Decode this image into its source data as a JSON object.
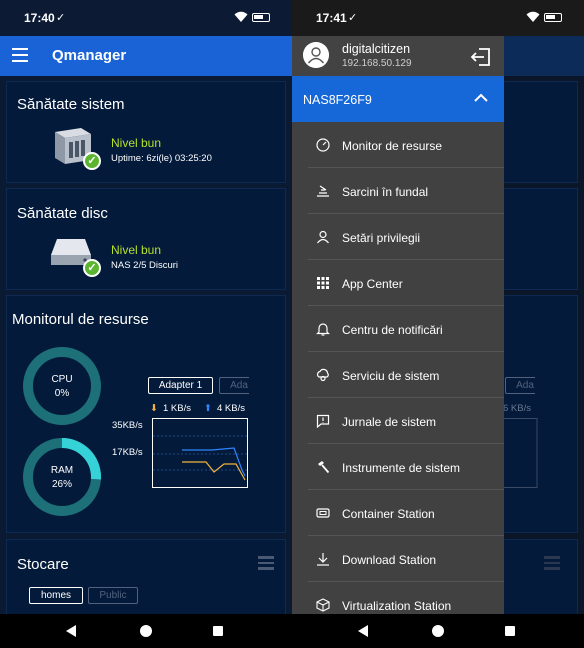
{
  "left": {
    "status_bar": {
      "time": "17:40",
      "check": "✓"
    },
    "app_title": "Qmanager",
    "system_health": {
      "title": "Sănătate sistem",
      "status": "Nivel bun",
      "detail": "Uptime: 6zi(le) 03:25:20"
    },
    "disk_health": {
      "title": "Sănătate disc",
      "status": "Nivel bun",
      "detail": "NAS 2/5 Discuri"
    },
    "resource_monitor": {
      "title": "Monitorul de resurse",
      "cpu": {
        "label": "CPU",
        "value": "0%",
        "fraction": 0.0
      },
      "ram": {
        "label": "RAM",
        "value": "26%",
        "fraction": 0.26
      },
      "tabs": [
        "Adapter 1",
        "Ada"
      ],
      "download": "1 KB/s",
      "upload": "4 KB/s",
      "y_ticks": [
        "35KB/s",
        "17KB/s"
      ],
      "colors": {
        "download": "#f1b33d",
        "upload": "#2e86ff",
        "cpu_track": "#1d6f78",
        "ram_fill": "#35d3d8"
      }
    },
    "storage": {
      "title": "Stocare",
      "tabs": [
        "homes",
        "Public"
      ]
    }
  },
  "right": {
    "status_bar": {
      "time": "17:41",
      "check": "✓"
    },
    "drawer": {
      "username": "digitalcitizen",
      "ip": "192.168.50.129",
      "nas_name": "NAS8F26F9",
      "items": [
        {
          "label": "Monitor de resurse",
          "icon": "gauge-icon"
        },
        {
          "label": "Sarcini în fundal",
          "icon": "tasks-icon"
        },
        {
          "label": "Setări privilegii",
          "icon": "user-icon"
        },
        {
          "label": "App Center",
          "icon": "apps-grid-icon"
        },
        {
          "label": "Centru de notificări",
          "icon": "bell-icon"
        },
        {
          "label": "Serviciu de sistem",
          "icon": "cloud-gear-icon"
        },
        {
          "label": "Jurnale de sistem",
          "icon": "log-icon"
        },
        {
          "label": "Instrumente de sistem",
          "icon": "hammer-icon"
        },
        {
          "label": "Container Station",
          "icon": "container-icon"
        },
        {
          "label": "Download Station",
          "icon": "download-icon"
        },
        {
          "label": "Virtualization Station",
          "icon": "cube-icon"
        }
      ]
    },
    "background": {
      "tab_partial": "Ada",
      "speed_partial": "6 KB/s"
    }
  }
}
